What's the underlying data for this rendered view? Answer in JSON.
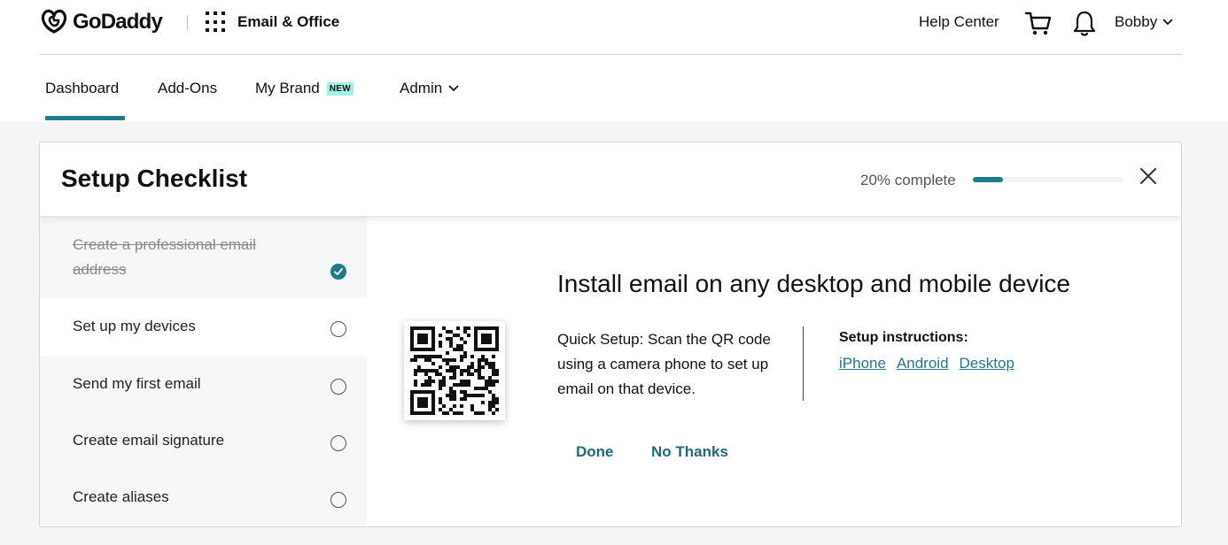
{
  "brand": {
    "logo_text": "GoDaddy",
    "product": "Email & Office"
  },
  "header": {
    "help": "Help Center",
    "user": "Bobby"
  },
  "nav": {
    "items": [
      {
        "label": "Dashboard"
      },
      {
        "label": "Add-Ons"
      },
      {
        "label": "My Brand",
        "badge": "NEW"
      },
      {
        "label": "Admin"
      }
    ]
  },
  "checklist": {
    "title": "Setup Checklist",
    "progress_label": "20% complete",
    "progress_fraction": 0.2,
    "items": [
      {
        "label_line1": "Create a professional email",
        "label_line2": "address",
        "done": true
      },
      {
        "label": "Set up my devices"
      },
      {
        "label": "Send my first email"
      },
      {
        "label": "Create email signature"
      },
      {
        "label": "Create aliases"
      }
    ]
  },
  "panel": {
    "title": "Install email on any desktop and mobile device",
    "quick_setup": "Quick Setup: Scan the QR code using a camera phone to set up email on that device.",
    "instructions_heading": "Setup instructions:",
    "links": [
      "iPhone",
      "Android",
      "Desktop"
    ],
    "done_label": "Done",
    "no_thanks_label": "No Thanks"
  },
  "colors": {
    "accent": "#1f7a8c",
    "badge_bg": "#9ff0e6"
  }
}
